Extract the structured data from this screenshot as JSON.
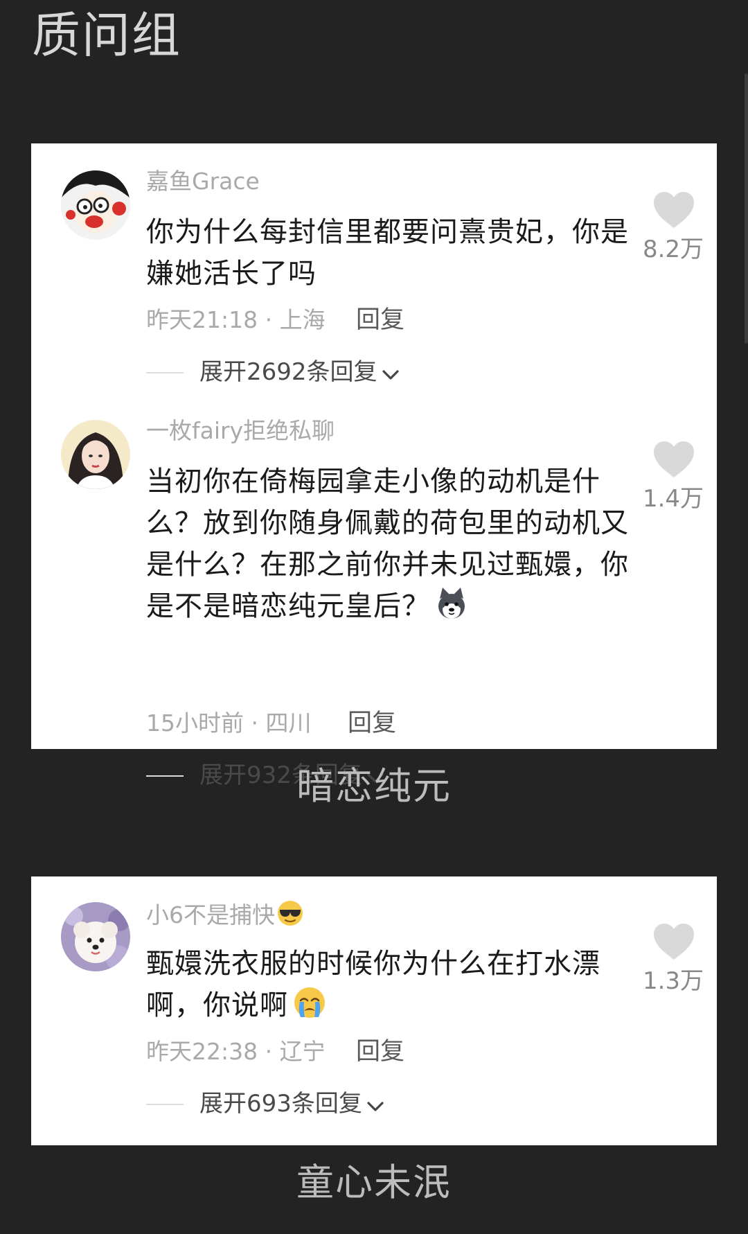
{
  "page_title": "质问组",
  "groups": [
    {
      "caption": "暗恋纯元",
      "comments": [
        {
          "username": "嘉鱼Grace",
          "text": "你为什么每封信里都要问熹贵妃，你是嫌她活长了吗",
          "meta": "昨天21:18 · 上海",
          "reply_label": "回复",
          "expand_label": "展开2692条回复",
          "likes": "8.2万",
          "avatar_icon": "cartoon-face-avatar"
        },
        {
          "username": "一枚fairy拒绝私聊",
          "text": "当初你在倚梅园拿走小像的动机是什么？放到你随身佩戴的荷包里的动机又是什么？在那之前你并未见过甄嬛，你是不是暗恋纯元皇后？",
          "emoji": "husky-dog-emoji",
          "meta": "15小时前 · 四川",
          "reply_label": "回复",
          "expand_label": "展开932条回复",
          "likes": "1.4万",
          "avatar_icon": "woman-portrait-avatar"
        }
      ]
    },
    {
      "caption": "童心未泯",
      "comments": [
        {
          "username": "小6不是捕快",
          "username_emoji": "sunglasses-face-emoji",
          "text": "甄嬛洗衣服的时候你为什么在打水漂啊，你说啊",
          "emoji": "crying-face-emoji",
          "meta": "昨天22:38 · 辽宁",
          "reply_label": "回复",
          "expand_label": "展开693条回复",
          "likes": "1.3万",
          "avatar_icon": "white-dog-avatar"
        }
      ]
    }
  ],
  "colors": {
    "background": "#232323",
    "card": "#ffffff",
    "username": "#a9a9a9",
    "comment_text": "#1a1a1a",
    "like_icon": "#d9d9d9"
  }
}
